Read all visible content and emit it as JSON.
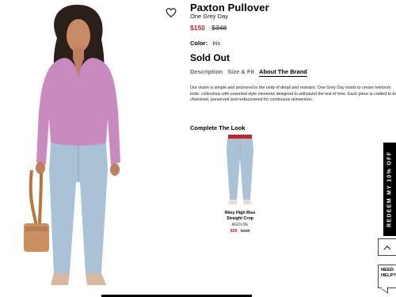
{
  "product": {
    "title": "Paxton Pullover",
    "brand": "One Grey Day",
    "price_sale": "$150",
    "price_original": "$348",
    "color_label": "Color:",
    "color_value": "Iris",
    "status": "Sold Out"
  },
  "tabs": [
    {
      "label": "Description",
      "active": false
    },
    {
      "label": "Size & Fit",
      "active": false
    },
    {
      "label": "About The Brand",
      "active": true
    }
  ],
  "about_text": "Our vision is simple and anchored in the unity of detail and restraint. One Grey Day exists to create heirloom knits: collections with essential style elements designed to withstand the test of time. Each piece is crafted to be cherished, preserved and rediscovered for continuous reinvention.",
  "complete_look": {
    "heading": "Complete The Look",
    "item": {
      "name": "Riley High Rise Straight Crop",
      "brand": "AGOLDE",
      "price_sale": "$98",
      "price_original": "$198"
    }
  },
  "promo": {
    "redeem": "REDEEM MY 10% OFF"
  },
  "help": {
    "label": "NEED HELP?"
  },
  "icons": {
    "wishlist": "heart-outline-icon",
    "scroll_top": "chevron-up-icon"
  },
  "colors": {
    "sale_price": "#c0262d",
    "sweater": "#c98bbf",
    "jeans": "#a9c2d6",
    "bag": "#c98f5f"
  }
}
